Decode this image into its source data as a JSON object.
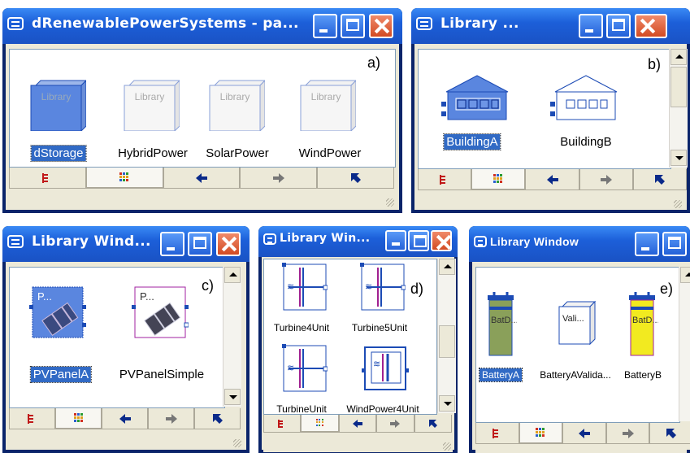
{
  "windows": [
    {
      "title": "dRenewablePowerSystems - pa...",
      "panel_letter": "a)",
      "items": [
        "dStorage",
        "HybridPower",
        "SolarPower",
        "WindPower"
      ],
      "selected": "dStorage",
      "icon_text": "Library"
    },
    {
      "title": "Library ...",
      "panel_letter": "b)",
      "items": [
        "BuildingA",
        "BuildingB"
      ],
      "selected": "BuildingA"
    },
    {
      "title": "Library Wind...",
      "panel_letter": "c)",
      "items": [
        "PVPanelA",
        "PVPanelSimple"
      ],
      "selected": "PVPanelA",
      "icon_text": "P..."
    },
    {
      "title": "Library Win...",
      "panel_letter": "d)",
      "items": [
        "Turbine4Unit",
        "Turbine5Unit",
        "TurbineUnit",
        "WindPower4Unit"
      ]
    },
    {
      "title": "Library Window",
      "panel_letter": "e)",
      "items": [
        "BatteryA",
        "BatteryAValida...",
        "BatteryB"
      ],
      "selected": "BatteryA",
      "icon_texts": [
        "BatD...",
        "Vali...",
        "BatD..."
      ]
    }
  ],
  "toolbar_icons": [
    "tree-view-icon",
    "icon-view-icon",
    "back-arrow-icon",
    "forward-arrow-icon",
    "up-arrow-icon"
  ],
  "colors": {
    "title_blue": "#1c5fd9",
    "selection": "#316ac5",
    "close_red": "#d24a22"
  }
}
